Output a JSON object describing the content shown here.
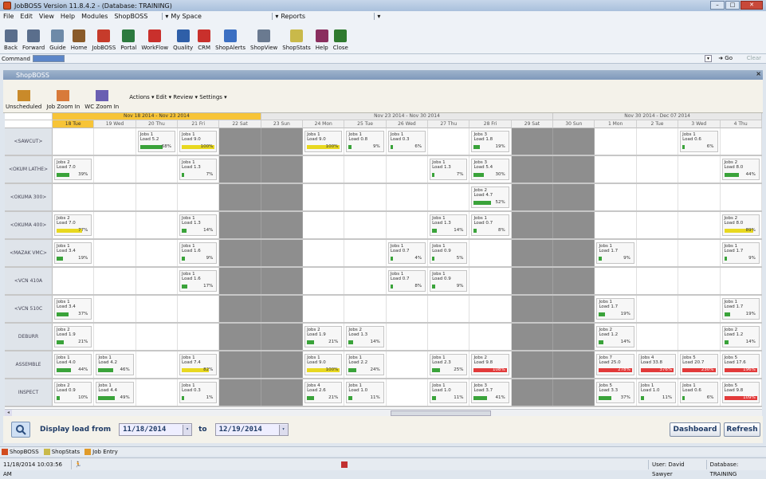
{
  "window": {
    "title": "JobBOSS Version 11.8.4.2 - (Database: TRAINING)"
  },
  "menu": {
    "items": [
      "File",
      "Edit",
      "View",
      "Help",
      "Modules",
      "ShopBOSS"
    ],
    "myspace": "My Space",
    "reports": "Reports"
  },
  "toolbar": {
    "buttons": [
      "Back",
      "Forward",
      "Guide",
      "Home",
      "JobBOSS",
      "Portal",
      "WorkFlow",
      "Quality",
      "CRM",
      "ShopAlerts",
      "ShopView",
      "ShopStats",
      "Help",
      "Close"
    ],
    "colors": [
      "#5a6e8c",
      "#5a6e8c",
      "#6e8aa8",
      "#8a5b2a",
      "#c63b2b",
      "#2c7a3f",
      "#c9302c",
      "#2f5fa8",
      "#c9302c",
      "#3b6fc2",
      "#6a7a90",
      "#c9b94a",
      "#8a2f5f",
      "#2f7a2f"
    ]
  },
  "command": {
    "label": "Command",
    "go": "Go",
    "clear": "Clear"
  },
  "shopboss": {
    "title": "ShopBOSS",
    "buttons": [
      "Unscheduled",
      "Job Zoom In",
      "WC Zoom In"
    ],
    "menus": "Actions ▾  Edit ▾  Review ▾  Settings ▾"
  },
  "grid": {
    "ranges": [
      "Nov 18 2014 - Nov 23 2014",
      "Nov 23 2014 - Nov 30 2014",
      "Nov 30 2014 - Dec 07 2014"
    ],
    "days": [
      "18 Tue",
      "19 Wed",
      "20 Thu",
      "21 Fri",
      "22 Sat",
      "23 Sun",
      "24 Mon",
      "25 Tue",
      "26 Wed",
      "27 Thu",
      "28 Fri",
      "29 Sat",
      "30 Sun",
      "1 Mon",
      "2 Tue",
      "3 Wed",
      "4 Thu"
    ],
    "weekend_cols": [
      4,
      5,
      11,
      12
    ],
    "workcenters": [
      {
        "name": "<SAWCUT>",
        "cells": [
          null,
          null,
          {
            "j": "Jobs 1",
            "l": "Load 5.2",
            "p": "68%",
            "f": 0.68,
            "c": "#3aa33a"
          },
          {
            "j": "Jobs 1",
            "l": "Load 9.0",
            "p": "100%",
            "f": 1.0,
            "c": "#e8d820"
          },
          null,
          null,
          {
            "j": "Jobs 1",
            "l": "Load 9.0",
            "p": "100%",
            "f": 1.0,
            "c": "#e8d820"
          },
          {
            "j": "Jobs 1",
            "l": "Load 0.8",
            "p": "9%",
            "f": 0.09,
            "c": "#3aa33a"
          },
          {
            "j": "Jobs 1",
            "l": "Load 0.3",
            "p": "6%",
            "f": 0.06,
            "c": "#3aa33a"
          },
          null,
          {
            "j": "Jobs 3",
            "l": "Load 1.8",
            "p": "19%",
            "f": 0.19,
            "c": "#3aa33a"
          },
          null,
          null,
          null,
          null,
          {
            "j": "Jobs 1",
            "l": "Load 0.6",
            "p": "6%",
            "f": 0.06,
            "c": "#3aa33a"
          },
          null
        ]
      },
      {
        "name": "<OKUM LATHE>",
        "cells": [
          {
            "j": "Jobs 2",
            "l": "Load 7.0",
            "p": "39%",
            "f": 0.39,
            "c": "#3aa33a"
          },
          null,
          null,
          {
            "j": "Jobs 1",
            "l": "Load 1.3",
            "p": "7%",
            "f": 0.07,
            "c": "#3aa33a"
          },
          null,
          null,
          null,
          null,
          null,
          {
            "j": "Jobs 1",
            "l": "Load 1.3",
            "p": "7%",
            "f": 0.07,
            "c": "#3aa33a"
          },
          {
            "j": "Jobs 3",
            "l": "Load 5.4",
            "p": "30%",
            "f": 0.3,
            "c": "#3aa33a"
          },
          null,
          null,
          null,
          null,
          null,
          {
            "j": "Jobs 2",
            "l": "Load 8.0",
            "p": "44%",
            "f": 0.44,
            "c": "#3aa33a"
          }
        ]
      },
      {
        "name": "<OKUMA 300>",
        "cells": [
          null,
          null,
          null,
          null,
          null,
          null,
          null,
          null,
          null,
          null,
          {
            "j": "Jobs 2",
            "l": "Load 4.7",
            "p": "52%",
            "f": 0.52,
            "c": "#3aa33a"
          },
          null,
          null,
          null,
          null,
          null,
          null
        ]
      },
      {
        "name": "<OKUMA 400>",
        "cells": [
          {
            "j": "Jobs 2",
            "l": "Load 7.0",
            "p": "77%",
            "f": 0.77,
            "c": "#e8d820"
          },
          null,
          null,
          {
            "j": "Jobs 1",
            "l": "Load 1.3",
            "p": "14%",
            "f": 0.14,
            "c": "#3aa33a"
          },
          null,
          null,
          null,
          null,
          null,
          {
            "j": "Jobs 1",
            "l": "Load 1.3",
            "p": "14%",
            "f": 0.14,
            "c": "#3aa33a"
          },
          {
            "j": "Jobs 1",
            "l": "Load 0.7",
            "p": "8%",
            "f": 0.08,
            "c": "#3aa33a"
          },
          null,
          null,
          null,
          null,
          null,
          {
            "j": "Jobs 2",
            "l": "Load 8.0",
            "p": "89%",
            "f": 0.89,
            "c": "#e8d820"
          }
        ]
      },
      {
        "name": "<MAZAK VMC>",
        "cells": [
          {
            "j": "Jobs 1",
            "l": "Load 3.4",
            "p": "19%",
            "f": 0.19,
            "c": "#3aa33a"
          },
          null,
          null,
          {
            "j": "Jobs 1",
            "l": "Load 1.6",
            "p": "9%",
            "f": 0.09,
            "c": "#3aa33a"
          },
          null,
          null,
          null,
          null,
          {
            "j": "Jobs 1",
            "l": "Load 0.7",
            "p": "4%",
            "f": 0.04,
            "c": "#3aa33a"
          },
          {
            "j": "Jobs 1",
            "l": "Load 0.9",
            "p": "5%",
            "f": 0.05,
            "c": "#3aa33a"
          },
          null,
          null,
          null,
          {
            "j": "Jobs 1",
            "l": "Load 1.7",
            "p": "9%",
            "f": 0.09,
            "c": "#3aa33a"
          },
          null,
          null,
          {
            "j": "Jobs 1",
            "l": "Load 1.7",
            "p": "9%",
            "f": 0.09,
            "c": "#3aa33a"
          }
        ]
      },
      {
        "name": "<VCN 410A",
        "cells": [
          null,
          null,
          null,
          {
            "j": "Jobs 1",
            "l": "Load 1.6",
            "p": "17%",
            "f": 0.17,
            "c": "#3aa33a"
          },
          null,
          null,
          null,
          null,
          {
            "j": "Jobs 1",
            "l": "Load 0.7",
            "p": "8%",
            "f": 0.08,
            "c": "#3aa33a"
          },
          {
            "j": "Jobs 1",
            "l": "Load 0.9",
            "p": "9%",
            "f": 0.09,
            "c": "#3aa33a"
          },
          null,
          null,
          null,
          null,
          null,
          null,
          null
        ]
      },
      {
        "name": "<VCN 510C",
        "cells": [
          {
            "j": "Jobs 1",
            "l": "Load 3.4",
            "p": "37%",
            "f": 0.37,
            "c": "#3aa33a"
          },
          null,
          null,
          null,
          null,
          null,
          null,
          null,
          null,
          null,
          null,
          null,
          null,
          {
            "j": "Jobs 1",
            "l": "Load 1.7",
            "p": "19%",
            "f": 0.19,
            "c": "#3aa33a"
          },
          null,
          null,
          {
            "j": "Jobs 1",
            "l": "Load 1.7",
            "p": "19%",
            "f": 0.19,
            "c": "#3aa33a"
          }
        ]
      },
      {
        "name": "DEBURR",
        "cells": [
          {
            "j": "Jobs 2",
            "l": "Load 1.9",
            "p": "21%",
            "f": 0.21,
            "c": "#3aa33a"
          },
          null,
          null,
          null,
          null,
          null,
          {
            "j": "Jobs 2",
            "l": "Load 1.9",
            "p": "21%",
            "f": 0.21,
            "c": "#3aa33a"
          },
          {
            "j": "Jobs 2",
            "l": "Load 1.3",
            "p": "14%",
            "f": 0.14,
            "c": "#3aa33a"
          },
          null,
          null,
          null,
          null,
          null,
          {
            "j": "Jobs 2",
            "l": "Load 1.2",
            "p": "14%",
            "f": 0.14,
            "c": "#3aa33a"
          },
          null,
          null,
          {
            "j": "Jobs 2",
            "l": "Load 1.2",
            "p": "14%",
            "f": 0.14,
            "c": "#3aa33a"
          }
        ]
      },
      {
        "name": "ASSEMBLE",
        "cells": [
          {
            "j": "Jobs 1",
            "l": "Load 4.0",
            "p": "44%",
            "f": 0.44,
            "c": "#3aa33a"
          },
          {
            "j": "Jobs 1",
            "l": "Load 4.2",
            "p": "46%",
            "f": 0.46,
            "c": "#3aa33a"
          },
          null,
          {
            "j": "Jobs 1",
            "l": "Load 7.4",
            "p": "82%",
            "f": 0.82,
            "c": "#e8d820"
          },
          null,
          null,
          {
            "j": "Jobs 1",
            "l": "Load 9.0",
            "p": "100%",
            "f": 1.0,
            "c": "#e8d820"
          },
          {
            "j": "Jobs 1",
            "l": "Load 2.2",
            "p": "24%",
            "f": 0.24,
            "c": "#3aa33a"
          },
          null,
          {
            "j": "Jobs 1",
            "l": "Load 2.3",
            "p": "25%",
            "f": 0.25,
            "c": "#3aa33a"
          },
          {
            "j": "Jobs 2",
            "l": "Load 9.8",
            "p": "108%",
            "f": 1.0,
            "c": "#e23a3a"
          },
          null,
          null,
          {
            "j": "Jobs 7",
            "l": "Load 25.0",
            "p": "278%",
            "f": 1.0,
            "c": "#e23a3a"
          },
          {
            "j": "Jobs 4",
            "l": "Load 33.8",
            "p": "376%",
            "f": 1.0,
            "c": "#e23a3a"
          },
          {
            "j": "Jobs 5",
            "l": "Load 20.7",
            "p": "230%",
            "f": 1.0,
            "c": "#e23a3a"
          },
          {
            "j": "Jobs 5",
            "l": "Load 17.6",
            "p": "196%",
            "f": 1.0,
            "c": "#e23a3a"
          }
        ]
      },
      {
        "name": "INSPECT",
        "cells": [
          {
            "j": "Jobs 2",
            "l": "Load 0.9",
            "p": "10%",
            "f": 0.1,
            "c": "#3aa33a"
          },
          {
            "j": "Jobs 1",
            "l": "Load 4.4",
            "p": "49%",
            "f": 0.49,
            "c": "#3aa33a"
          },
          null,
          {
            "j": "Jobs 1",
            "l": "Load 0.3",
            "p": "1%",
            "f": 0.01,
            "c": "#3aa33a"
          },
          null,
          null,
          {
            "j": "Jobs 4",
            "l": "Load 2.6",
            "p": "21%",
            "f": 0.21,
            "c": "#3aa33a"
          },
          {
            "j": "Jobs 1",
            "l": "Load 1.0",
            "p": "11%",
            "f": 0.11,
            "c": "#3aa33a"
          },
          null,
          {
            "j": "Jobs 1",
            "l": "Load 1.0",
            "p": "11%",
            "f": 0.11,
            "c": "#3aa33a"
          },
          {
            "j": "Jobs 3",
            "l": "Load 3.7",
            "p": "41%",
            "f": 0.41,
            "c": "#3aa33a"
          },
          null,
          null,
          {
            "j": "Jobs 5",
            "l": "Load 3.3",
            "p": "37%",
            "f": 0.37,
            "c": "#3aa33a"
          },
          {
            "j": "Jobs 1",
            "l": "Load 1.0",
            "p": "11%",
            "f": 0.11,
            "c": "#3aa33a"
          },
          {
            "j": "Jobs 1",
            "l": "Load 0.6",
            "p": "6%",
            "f": 0.06,
            "c": "#3aa33a"
          },
          {
            "j": "Jobs 5",
            "l": "Load 9.8",
            "p": "109%",
            "f": 1.0,
            "c": "#e23a3a"
          }
        ]
      }
    ]
  },
  "footer": {
    "display_label": "Display load from",
    "from": "11/18/2014",
    "to_label": "to",
    "to": "12/19/2014",
    "dashboard": "Dashboard",
    "refresh": "Refresh"
  },
  "tabs": [
    "ShopBOSS",
    "ShopStats",
    "Job Entry"
  ],
  "status": {
    "datetime": "11/18/2014 10:03:56 AM",
    "user": "User: David Sawyer",
    "database": "Database: TRAINING"
  }
}
